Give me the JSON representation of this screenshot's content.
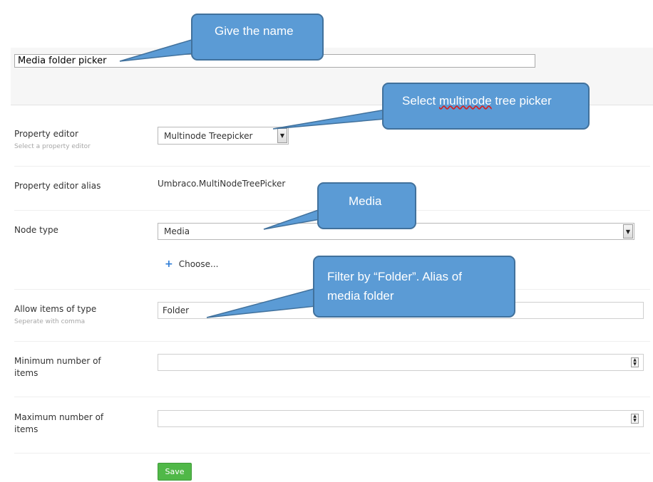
{
  "name_field": {
    "value": "Media folder picker"
  },
  "property_editor": {
    "label": "Property editor",
    "description": "Select a property editor",
    "selected": "Multinode Treepicker"
  },
  "property_editor_alias": {
    "label": "Property editor alias",
    "value": "Umbraco.MultiNodeTreePicker"
  },
  "node_type": {
    "label": "Node type",
    "selected": "Media",
    "choose_label": "Choose..."
  },
  "allow_items": {
    "label": "Allow items of type",
    "description": "Seperate with comma",
    "value": "Folder"
  },
  "min_items": {
    "label_line1": "Minimum number of",
    "label_line2": "items",
    "value": ""
  },
  "max_items": {
    "label_line1": "Maximum number of",
    "label_line2": "items",
    "value": ""
  },
  "save_label": "Save",
  "callouts": {
    "name": "Give the name",
    "tree_picker_prefix": "Select ",
    "tree_picker_word": "multinode",
    "tree_picker_suffix": " tree picker",
    "media": "Media",
    "filter_line1": "Filter by “Folder”. Alias of",
    "filter_line2": "media folder"
  },
  "colors": {
    "callout_fill": "#5b9bd5",
    "callout_border": "#41719c",
    "save_button": "#50b848"
  }
}
